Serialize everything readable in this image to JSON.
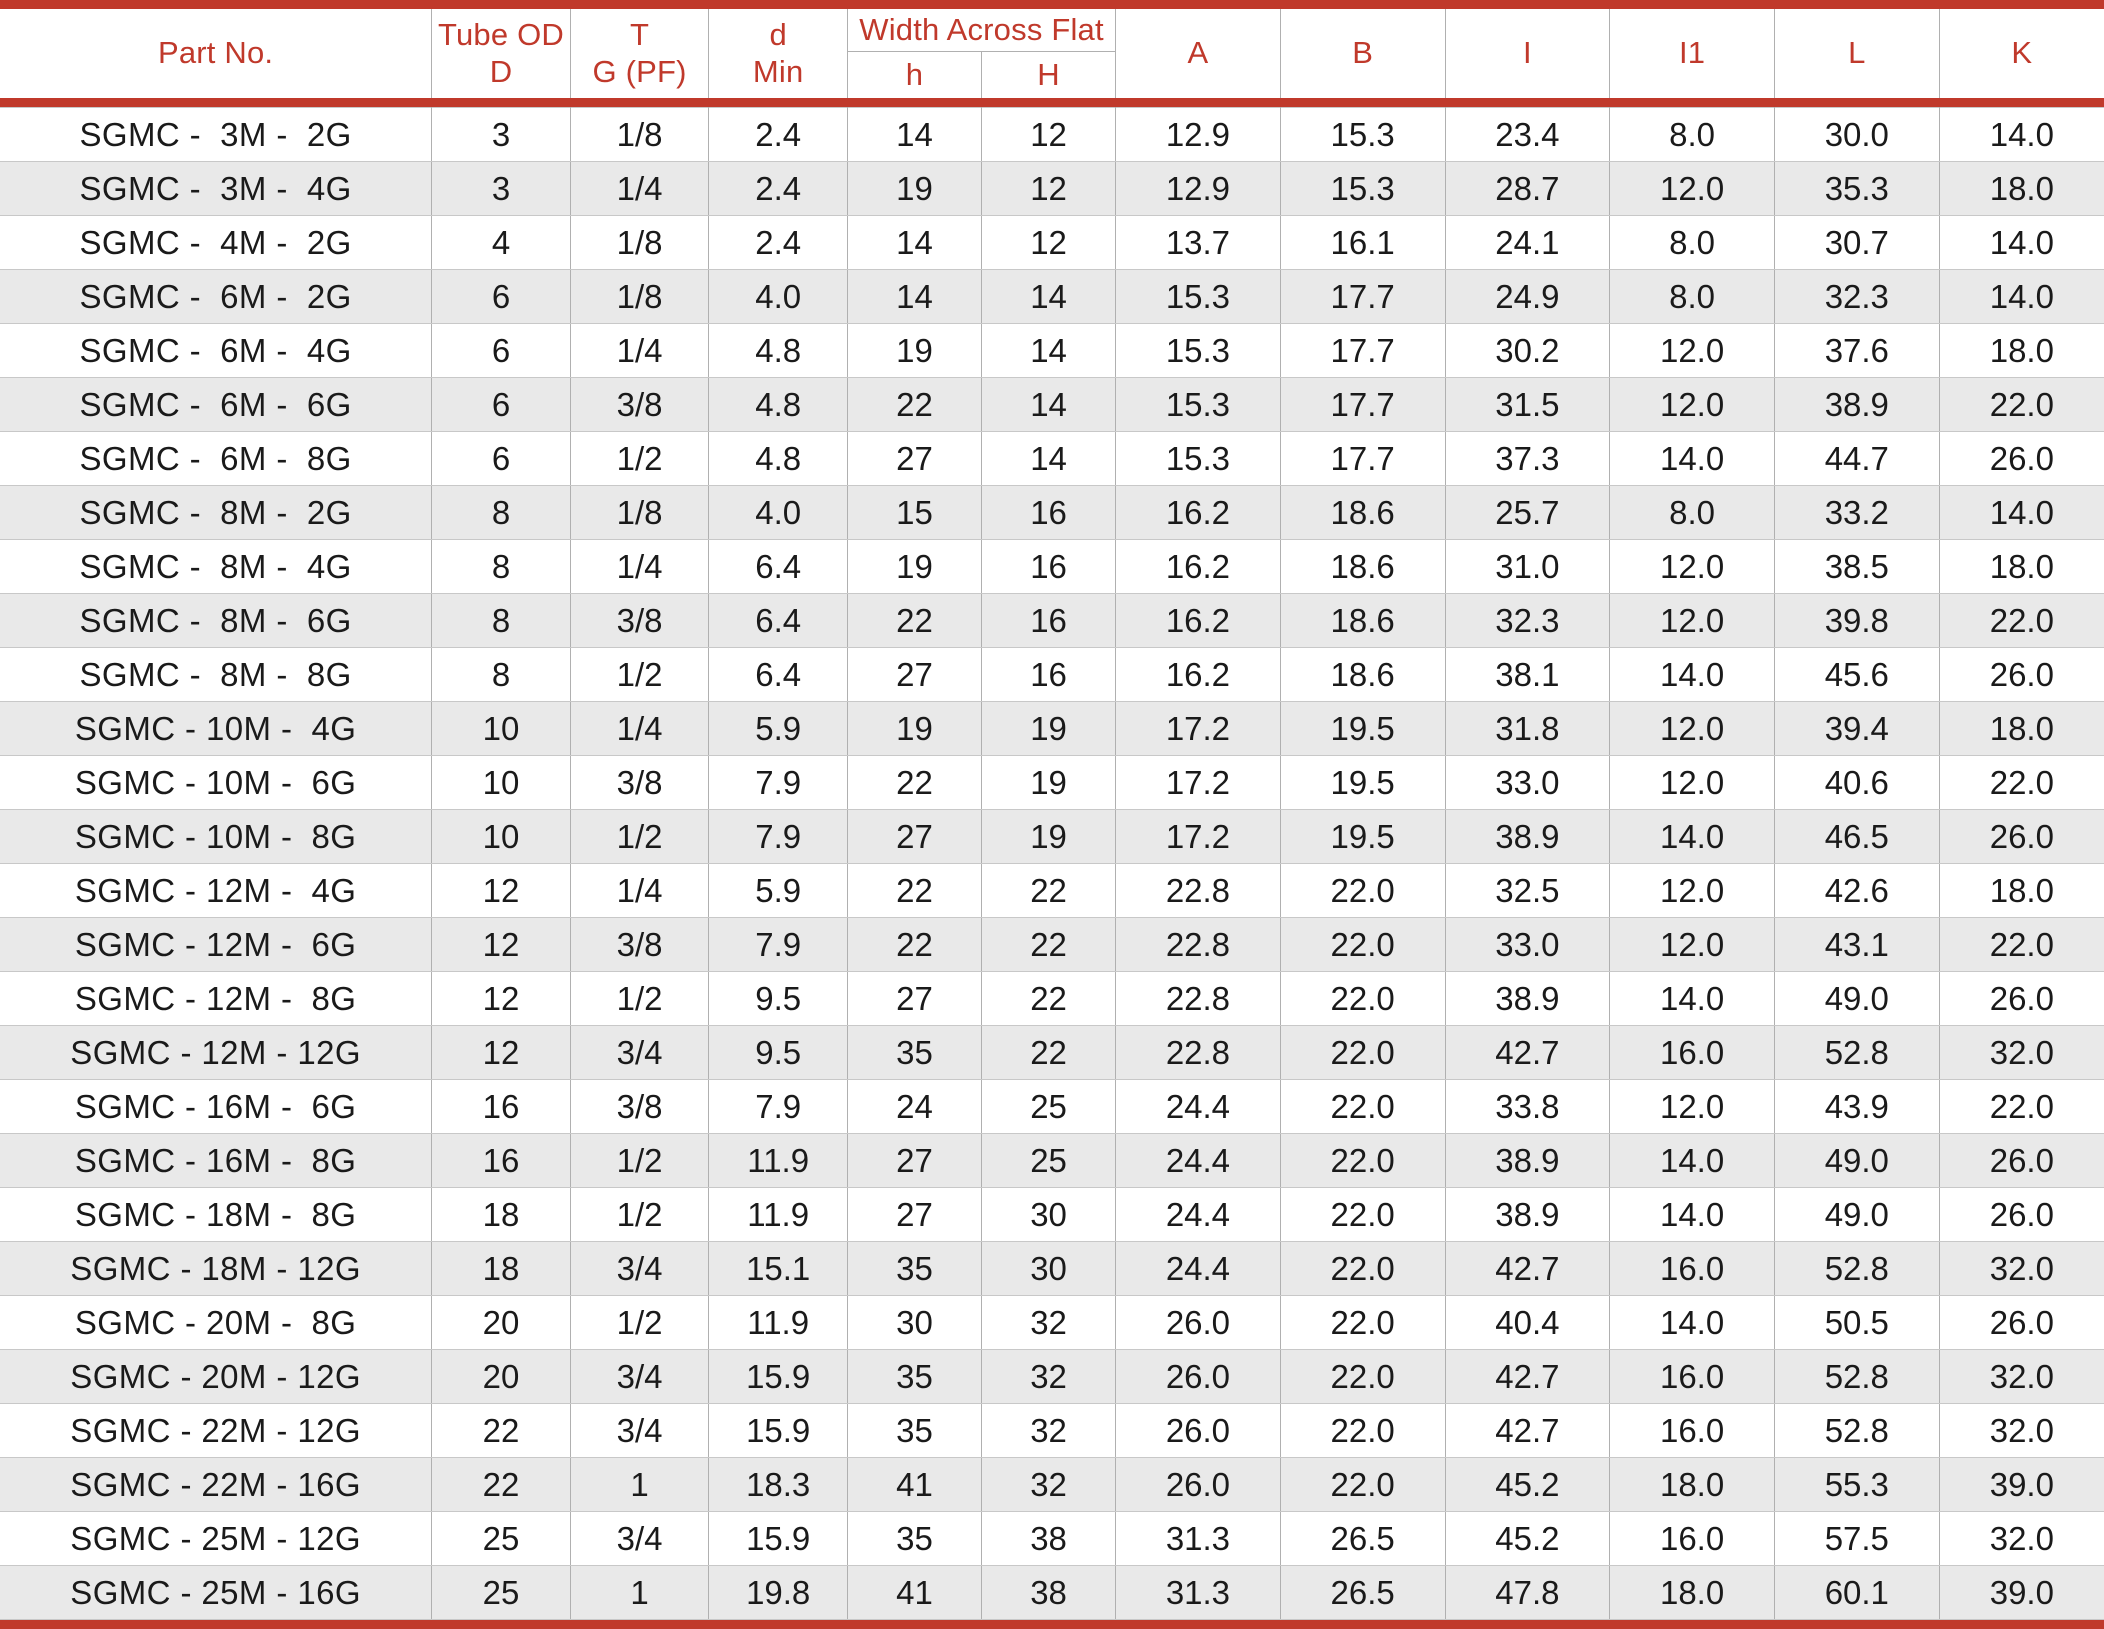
{
  "table": {
    "accent_color": "#c0392b",
    "grid_color": "#b0b0b0",
    "alt_row_color": "#e9e9e9",
    "headers": {
      "part_no": "Part No.",
      "tube_od_line1": "Tube OD",
      "tube_od_line2": "D",
      "t_line1": "T",
      "t_line2": "G (PF)",
      "d_line1": "d",
      "d_line2": "Min",
      "width_across_flat": "Width Across Flat",
      "waf_h": "h",
      "waf_H": "H",
      "a": "A",
      "b": "B",
      "i": "I",
      "i1": "I1",
      "l": "L",
      "k": "K"
    },
    "columns": [
      "part_no",
      "D",
      "T",
      "d",
      "h",
      "H",
      "A",
      "B",
      "I",
      "I1",
      "L",
      "K"
    ],
    "rows": [
      [
        "SGMC -  3M -  2G",
        "3",
        "1/8",
        "2.4",
        "14",
        "12",
        "12.9",
        "15.3",
        "23.4",
        "8.0",
        "30.0",
        "14.0"
      ],
      [
        "SGMC -  3M -  4G",
        "3",
        "1/4",
        "2.4",
        "19",
        "12",
        "12.9",
        "15.3",
        "28.7",
        "12.0",
        "35.3",
        "18.0"
      ],
      [
        "SGMC -  4M -  2G",
        "4",
        "1/8",
        "2.4",
        "14",
        "12",
        "13.7",
        "16.1",
        "24.1",
        "8.0",
        "30.7",
        "14.0"
      ],
      [
        "SGMC -  6M -  2G",
        "6",
        "1/8",
        "4.0",
        "14",
        "14",
        "15.3",
        "17.7",
        "24.9",
        "8.0",
        "32.3",
        "14.0"
      ],
      [
        "SGMC -  6M -  4G",
        "6",
        "1/4",
        "4.8",
        "19",
        "14",
        "15.3",
        "17.7",
        "30.2",
        "12.0",
        "37.6",
        "18.0"
      ],
      [
        "SGMC -  6M -  6G",
        "6",
        "3/8",
        "4.8",
        "22",
        "14",
        "15.3",
        "17.7",
        "31.5",
        "12.0",
        "38.9",
        "22.0"
      ],
      [
        "SGMC -  6M -  8G",
        "6",
        "1/2",
        "4.8",
        "27",
        "14",
        "15.3",
        "17.7",
        "37.3",
        "14.0",
        "44.7",
        "26.0"
      ],
      [
        "SGMC -  8M -  2G",
        "8",
        "1/8",
        "4.0",
        "15",
        "16",
        "16.2",
        "18.6",
        "25.7",
        "8.0",
        "33.2",
        "14.0"
      ],
      [
        "SGMC -  8M -  4G",
        "8",
        "1/4",
        "6.4",
        "19",
        "16",
        "16.2",
        "18.6",
        "31.0",
        "12.0",
        "38.5",
        "18.0"
      ],
      [
        "SGMC -  8M -  6G",
        "8",
        "3/8",
        "6.4",
        "22",
        "16",
        "16.2",
        "18.6",
        "32.3",
        "12.0",
        "39.8",
        "22.0"
      ],
      [
        "SGMC -  8M -  8G",
        "8",
        "1/2",
        "6.4",
        "27",
        "16",
        "16.2",
        "18.6",
        "38.1",
        "14.0",
        "45.6",
        "26.0"
      ],
      [
        "SGMC - 10M -  4G",
        "10",
        "1/4",
        "5.9",
        "19",
        "19",
        "17.2",
        "19.5",
        "31.8",
        "12.0",
        "39.4",
        "18.0"
      ],
      [
        "SGMC - 10M -  6G",
        "10",
        "3/8",
        "7.9",
        "22",
        "19",
        "17.2",
        "19.5",
        "33.0",
        "12.0",
        "40.6",
        "22.0"
      ],
      [
        "SGMC - 10M -  8G",
        "10",
        "1/2",
        "7.9",
        "27",
        "19",
        "17.2",
        "19.5",
        "38.9",
        "14.0",
        "46.5",
        "26.0"
      ],
      [
        "SGMC - 12M -  4G",
        "12",
        "1/4",
        "5.9",
        "22",
        "22",
        "22.8",
        "22.0",
        "32.5",
        "12.0",
        "42.6",
        "18.0"
      ],
      [
        "SGMC - 12M -  6G",
        "12",
        "3/8",
        "7.9",
        "22",
        "22",
        "22.8",
        "22.0",
        "33.0",
        "12.0",
        "43.1",
        "22.0"
      ],
      [
        "SGMC - 12M -  8G",
        "12",
        "1/2",
        "9.5",
        "27",
        "22",
        "22.8",
        "22.0",
        "38.9",
        "14.0",
        "49.0",
        "26.0"
      ],
      [
        "SGMC - 12M - 12G",
        "12",
        "3/4",
        "9.5",
        "35",
        "22",
        "22.8",
        "22.0",
        "42.7",
        "16.0",
        "52.8",
        "32.0"
      ],
      [
        "SGMC - 16M -  6G",
        "16",
        "3/8",
        "7.9",
        "24",
        "25",
        "24.4",
        "22.0",
        "33.8",
        "12.0",
        "43.9",
        "22.0"
      ],
      [
        "SGMC - 16M -  8G",
        "16",
        "1/2",
        "11.9",
        "27",
        "25",
        "24.4",
        "22.0",
        "38.9",
        "14.0",
        "49.0",
        "26.0"
      ],
      [
        "SGMC - 18M -  8G",
        "18",
        "1/2",
        "11.9",
        "27",
        "30",
        "24.4",
        "22.0",
        "38.9",
        "14.0",
        "49.0",
        "26.0"
      ],
      [
        "SGMC - 18M - 12G",
        "18",
        "3/4",
        "15.1",
        "35",
        "30",
        "24.4",
        "22.0",
        "42.7",
        "16.0",
        "52.8",
        "32.0"
      ],
      [
        "SGMC - 20M -  8G",
        "20",
        "1/2",
        "11.9",
        "30",
        "32",
        "26.0",
        "22.0",
        "40.4",
        "14.0",
        "50.5",
        "26.0"
      ],
      [
        "SGMC - 20M - 12G",
        "20",
        "3/4",
        "15.9",
        "35",
        "32",
        "26.0",
        "22.0",
        "42.7",
        "16.0",
        "52.8",
        "32.0"
      ],
      [
        "SGMC - 22M - 12G",
        "22",
        "3/4",
        "15.9",
        "35",
        "32",
        "26.0",
        "22.0",
        "42.7",
        "16.0",
        "52.8",
        "32.0"
      ],
      [
        "SGMC - 22M - 16G",
        "22",
        "1",
        "18.3",
        "41",
        "32",
        "26.0",
        "22.0",
        "45.2",
        "18.0",
        "55.3",
        "39.0"
      ],
      [
        "SGMC - 25M - 12G",
        "25",
        "3/4",
        "15.9",
        "35",
        "38",
        "31.3",
        "26.5",
        "45.2",
        "16.0",
        "57.5",
        "32.0"
      ],
      [
        "SGMC - 25M - 16G",
        "25",
        "1",
        "19.8",
        "41",
        "38",
        "31.3",
        "26.5",
        "47.8",
        "18.0",
        "60.1",
        "39.0"
      ]
    ]
  }
}
